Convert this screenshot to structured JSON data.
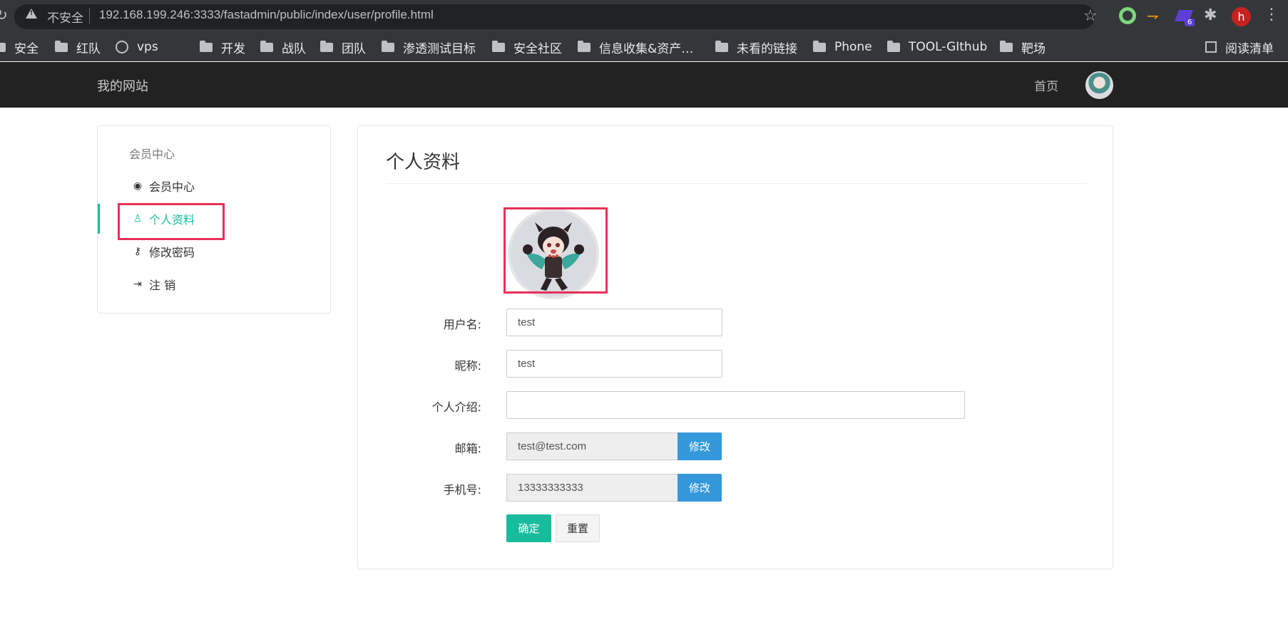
{
  "browser": {
    "insecure_label": "不安全",
    "url": "192.168.199.246:3333/fastadmin/public/index/user/profile.html",
    "ext_badge": "6",
    "profile_initial": "h",
    "reading_list": "阅读清单"
  },
  "bookmarks": [
    {
      "label": "安全",
      "icon": "folder-icon"
    },
    {
      "label": "红队",
      "icon": "folder-icon"
    },
    {
      "label": "vps",
      "icon": "globe-icon"
    },
    {
      "label": "开发",
      "icon": "folder-icon"
    },
    {
      "label": "战队",
      "icon": "folder-icon"
    },
    {
      "label": "团队",
      "icon": "folder-icon"
    },
    {
      "label": "渗透测试目标",
      "icon": "folder-icon"
    },
    {
      "label": "安全社区",
      "icon": "folder-icon"
    },
    {
      "label": "信息收集&资产…",
      "icon": "folder-icon"
    },
    {
      "label": "未看的链接",
      "icon": "folder-icon"
    },
    {
      "label": "Phone",
      "icon": "folder-icon"
    },
    {
      "label": "TOOL-GIthub",
      "icon": "folder-icon"
    },
    {
      "label": "靶场",
      "icon": "folder-icon"
    }
  ],
  "navbar": {
    "brand": "我的网站",
    "home": "首页"
  },
  "sidebar": {
    "heading": "会员中心",
    "items": [
      {
        "label": "会员中心",
        "icon": "user-circle-icon"
      },
      {
        "label": "个人资料",
        "icon": "user-icon",
        "active": true
      },
      {
        "label": "修改密码",
        "icon": "key-icon"
      },
      {
        "label": "注 销",
        "icon": "sign-out-icon"
      }
    ]
  },
  "main": {
    "title": "个人资料",
    "form": {
      "username_label": "用户名:",
      "username_value": "test",
      "nickname_label": "昵称:",
      "nickname_value": "test",
      "bio_label": "个人介绍:",
      "bio_value": "",
      "email_label": "邮箱:",
      "email_value": "test@test.com",
      "mobile_label": "手机号:",
      "mobile_value": "13333333333",
      "edit_label": "修改",
      "confirm_label": "确定",
      "reset_label": "重置"
    }
  },
  "colors": {
    "primary": "#18bc9c",
    "info": "#3498db",
    "highlight": "#e8305a",
    "navbar": "#222222"
  }
}
